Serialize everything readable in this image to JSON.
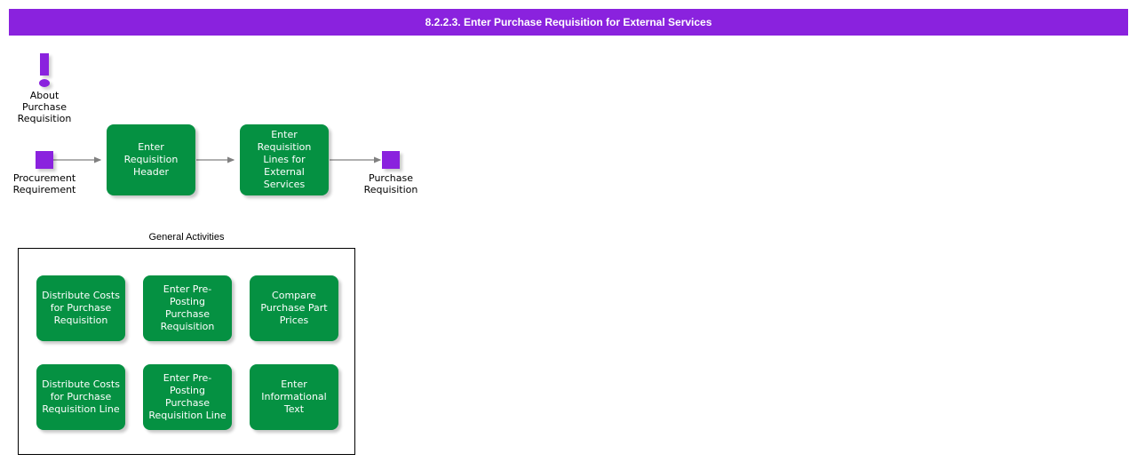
{
  "header": {
    "title": "8.2.2.3. Enter Purchase Requisition for External Services",
    "background_color": "#8a22de",
    "text_color": "#ffffff"
  },
  "colors": {
    "process_green": "#059142",
    "node_purple": "#8a22de",
    "connector_gray": "#808080",
    "group_border": "#000000",
    "canvas_background": "#ffffff"
  },
  "flow": {
    "info_node": {
      "icon": "exclamation-mark-icon",
      "label": "About\nPurchase\nRequisition"
    },
    "input_node": {
      "icon": "purple-square-icon",
      "label": "Procurement\nRequirement"
    },
    "steps": [
      {
        "label": "Enter Requisition\nHeader"
      },
      {
        "label": "Enter Requisition\nLines for\nExternal\nServices"
      }
    ],
    "output_node": {
      "icon": "purple-square-icon",
      "label": "Purchase\nRequisition"
    }
  },
  "general_activities": {
    "title": "General Activities",
    "items": [
      {
        "label": "Distribute Costs\nfor Purchase\nRequisition"
      },
      {
        "label": "Enter Pre-\nPosting\nPurchase\nRequisition"
      },
      {
        "label": "Compare\nPurchase Part\nPrices"
      },
      {
        "label": "Distribute Costs\nfor Purchase\nRequisition Line"
      },
      {
        "label": "Enter Pre-\nPosting\nPurchase\nRequisition Line"
      },
      {
        "label": "Enter\nInformational\nText"
      }
    ]
  }
}
